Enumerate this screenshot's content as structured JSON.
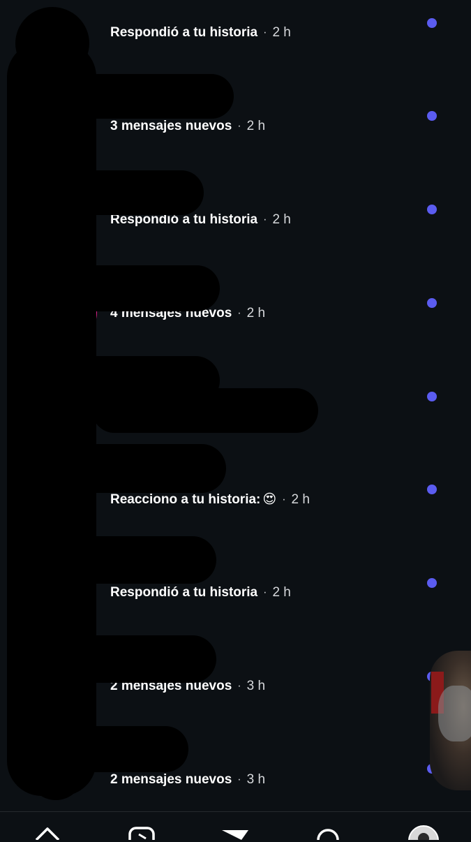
{
  "messages": [
    {
      "status": "Respondió a tu historia",
      "time": "2 h",
      "emoji": ""
    },
    {
      "status": "3 mensajes nuevos",
      "time": "2 h",
      "emoji": ""
    },
    {
      "status": "Respondió a tu historia",
      "time": "2 h",
      "emoji": ""
    },
    {
      "status": "4 mensajes nuevos",
      "time": "2 h",
      "emoji": ""
    },
    {
      "status": "",
      "time": "",
      "emoji": ""
    },
    {
      "status": "Reacciono a tu historia:",
      "time": "2 h",
      "emoji": "😍"
    },
    {
      "status": "Respondió a tu historia",
      "time": "2 h",
      "emoji": ""
    },
    {
      "status": "2 mensajes nuevos",
      "time": "3 h",
      "emoji": ""
    },
    {
      "status": "2 mensajes nuevos",
      "time": "3 h",
      "emoji": ""
    }
  ],
  "separator": "·",
  "colors": {
    "background": "#0c1014",
    "unread_dot": "#5b5cf0",
    "story_ring": "#e0218a",
    "text": "#ffffff",
    "secondary_text": "#d7d9dc"
  },
  "bottom_nav": {
    "icons": [
      "home-icon",
      "reels-icon",
      "send-icon",
      "search-icon",
      "profile-icon"
    ]
  }
}
